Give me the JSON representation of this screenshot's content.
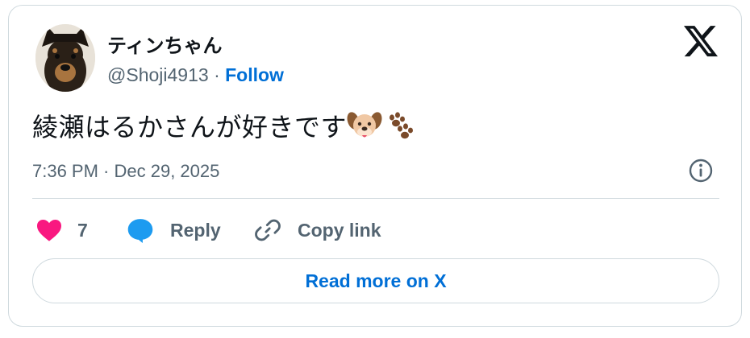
{
  "user": {
    "display_name": "ティンちゃん",
    "handle": "@Shoji4913",
    "separator": "·",
    "follow_label": "Follow"
  },
  "tweet": {
    "text": "綾瀬はるかさんが好きです",
    "emojis": [
      "dog-face-icon",
      "paw-prints-icon"
    ],
    "timestamp": "7:36 PM · Dec 29, 2025"
  },
  "actions": {
    "like_count": "7",
    "reply_label": "Reply",
    "copy_link_label": "Copy link"
  },
  "read_more_label": "Read more on X",
  "colors": {
    "accent_blue": "#006fd6",
    "like_pink": "#f91880",
    "reply_blue": "#1d9bf0",
    "muted_text": "#536471",
    "border": "#cfd9de"
  }
}
